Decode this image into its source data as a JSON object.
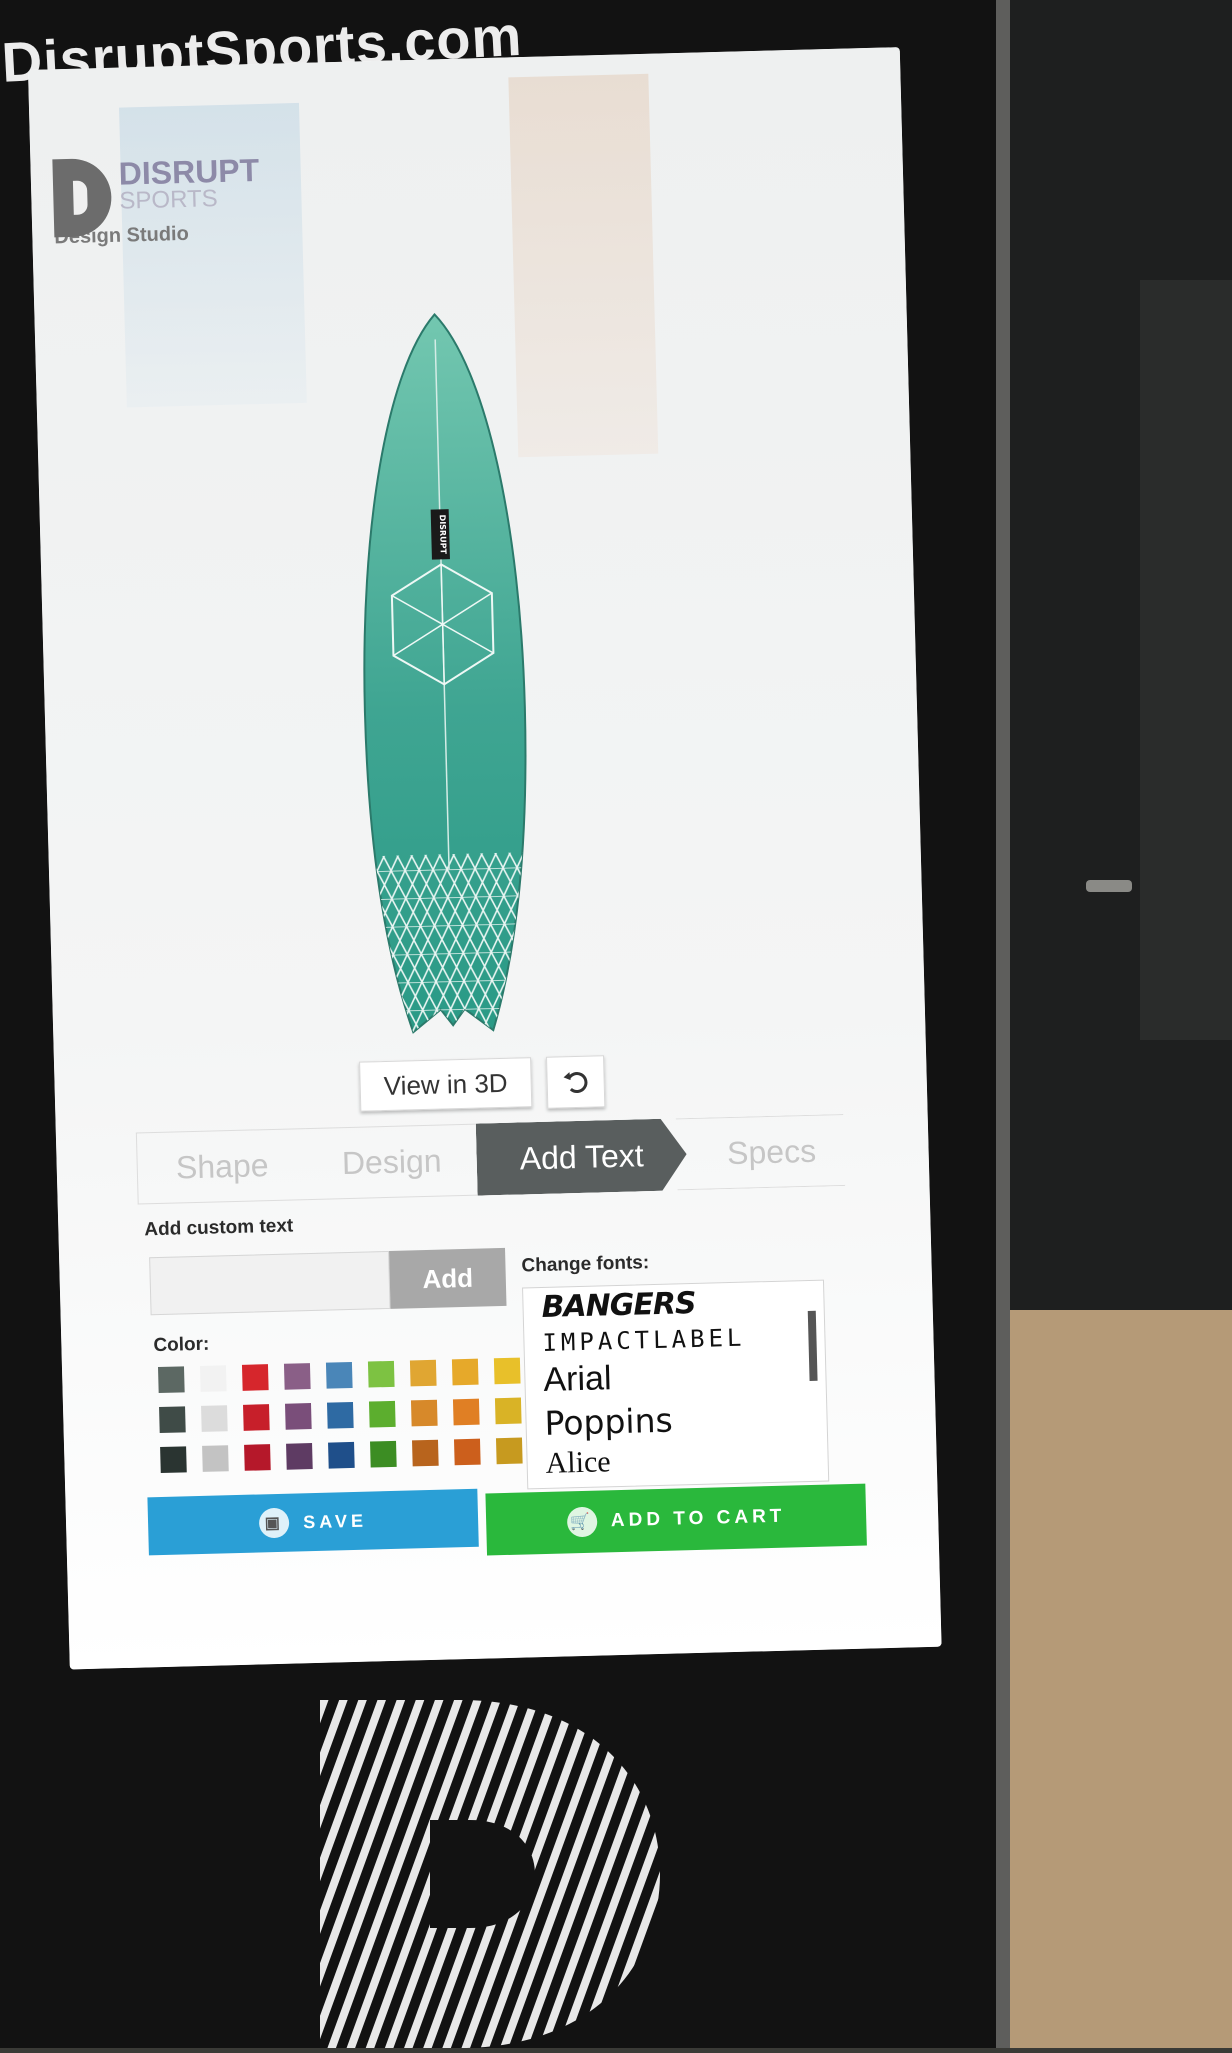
{
  "kiosk": {
    "brand_url": "DisruptSports.com"
  },
  "logo": {
    "line1": "DISRUPT",
    "line2": "SPORTS",
    "line3": "Design Studio"
  },
  "board": {
    "sticker_text": "DISRUPT"
  },
  "controls": {
    "view_3d_label": "View in 3D",
    "reset_icon": "undo-icon"
  },
  "tabs": [
    {
      "label": "Shape",
      "active": false
    },
    {
      "label": "Design",
      "active": false
    },
    {
      "label": "Add Text",
      "active": true
    },
    {
      "label": "Specs",
      "active": false
    }
  ],
  "custom_text": {
    "label": "Add custom text",
    "value": "",
    "add_label": "Add"
  },
  "color": {
    "label": "Color:",
    "swatches": [
      "#5c6863",
      "#f2f2f2",
      "#d6262c",
      "#8a5f87",
      "#4a86b8",
      "#7dc242",
      "#e0a632",
      "#e6a92a",
      "#e8c02a",
      "#3f4b47",
      "#dcdcdc",
      "#c71f2a",
      "#7a4e7a",
      "#2e6aa3",
      "#5cae2e",
      "#d7892a",
      "#e07f24",
      "#d9b326",
      "#2a3431",
      "#c3c3c3",
      "#b5182a",
      "#5e3b63",
      "#1f4f8a",
      "#3c8d23",
      "#b8641d",
      "#cc5f1c",
      "#c79a1f"
    ]
  },
  "fonts": {
    "label": "Change fonts:",
    "options": [
      "BANGERS",
      "IMPACTLABEL",
      "Arial",
      "Poppins",
      "Alice"
    ]
  },
  "actions": {
    "save_label": "SAVE",
    "save_icon": "save-icon",
    "cart_label": "ADD TO CART",
    "cart_icon": "cart-icon",
    "save_color": "#2a9fd6",
    "cart_color": "#2ab83c"
  }
}
